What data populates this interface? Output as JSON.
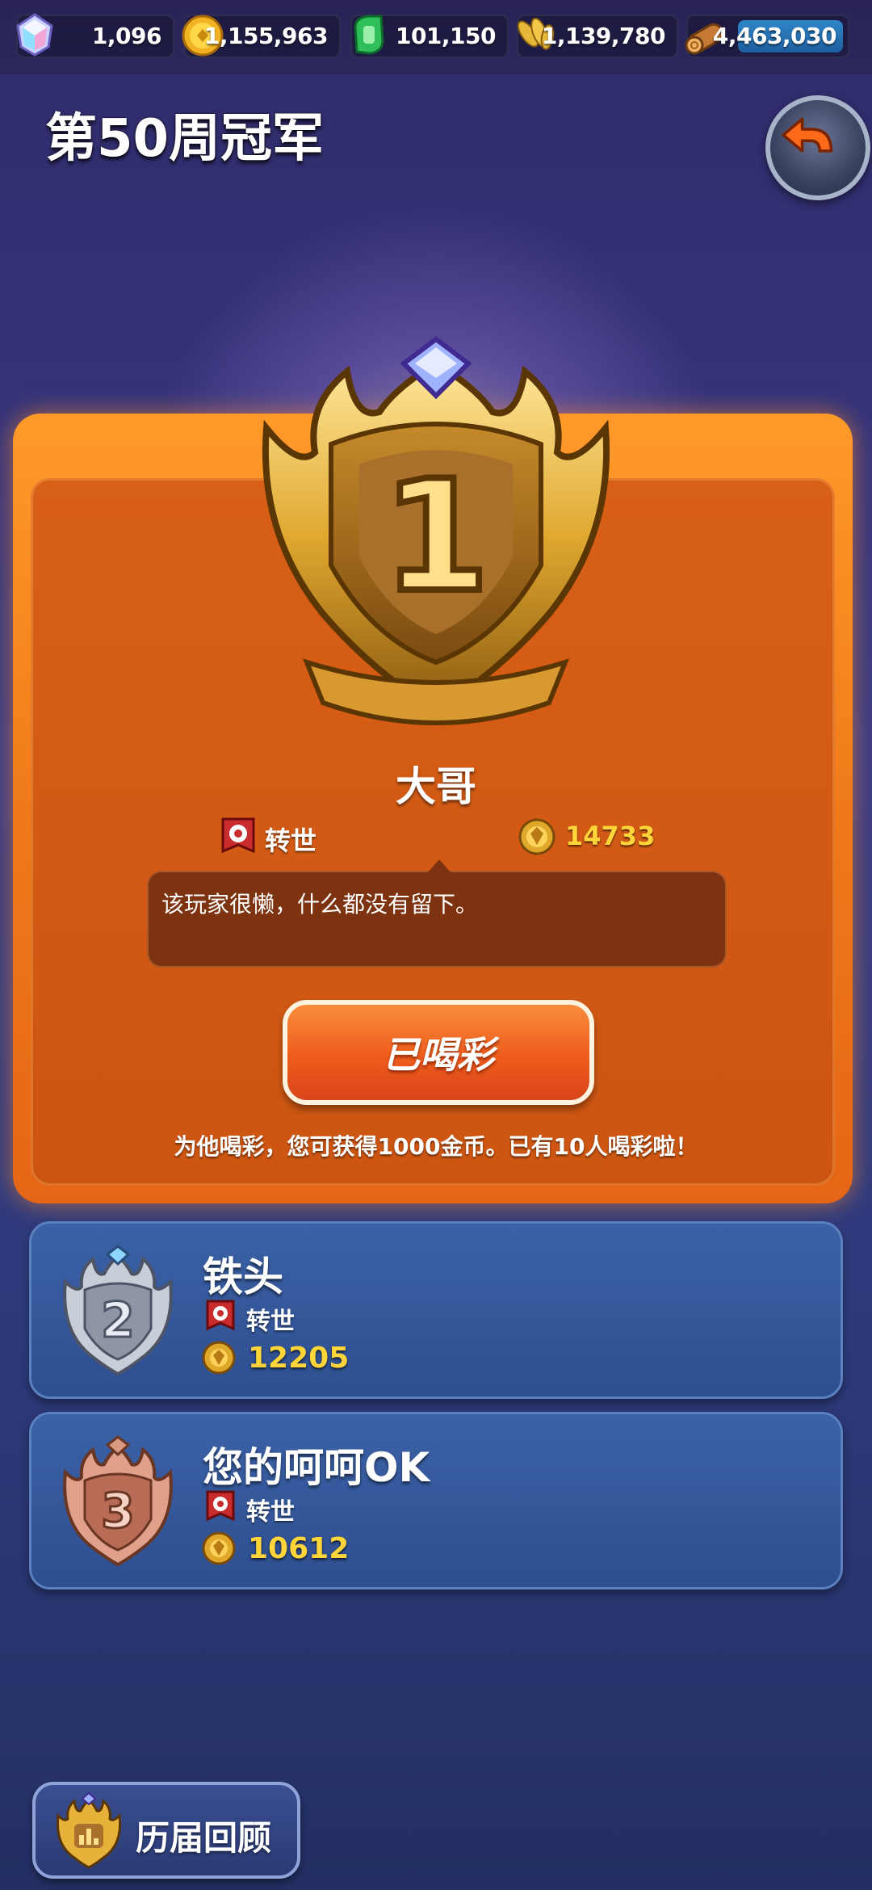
{
  "resources": [
    {
      "icon": "gem-icon",
      "value": "1,096"
    },
    {
      "icon": "gold-coin-icon",
      "value": "1,155,963"
    },
    {
      "icon": "green-token-icon",
      "value": "101,150"
    },
    {
      "icon": "wheat-icon",
      "value": "1,139,780"
    },
    {
      "icon": "wood-icon",
      "value": "4,463,030"
    }
  ],
  "header": {
    "title": "第50周冠军",
    "back_icon": "back-arrow-icon"
  },
  "winner": {
    "rank": "1",
    "name": "大哥",
    "title": "转世",
    "score": "14733",
    "message": "该玩家很懒，什么都没有留下。",
    "cheer_button": "已喝彩",
    "cheer_note": "为他喝彩，您可获得1000金币。已有10人喝彩啦！"
  },
  "ranks": [
    {
      "rank": "2",
      "name": "铁头",
      "title": "转世",
      "score": "12205"
    },
    {
      "rank": "3",
      "name": "您的呵呵OK",
      "title": "转世",
      "score": "10612"
    }
  ],
  "history_button": "历届回顾",
  "colors": {
    "gold": "#ffd53a",
    "orange": "#f07a1a",
    "card_blue": "#3b61a6"
  }
}
